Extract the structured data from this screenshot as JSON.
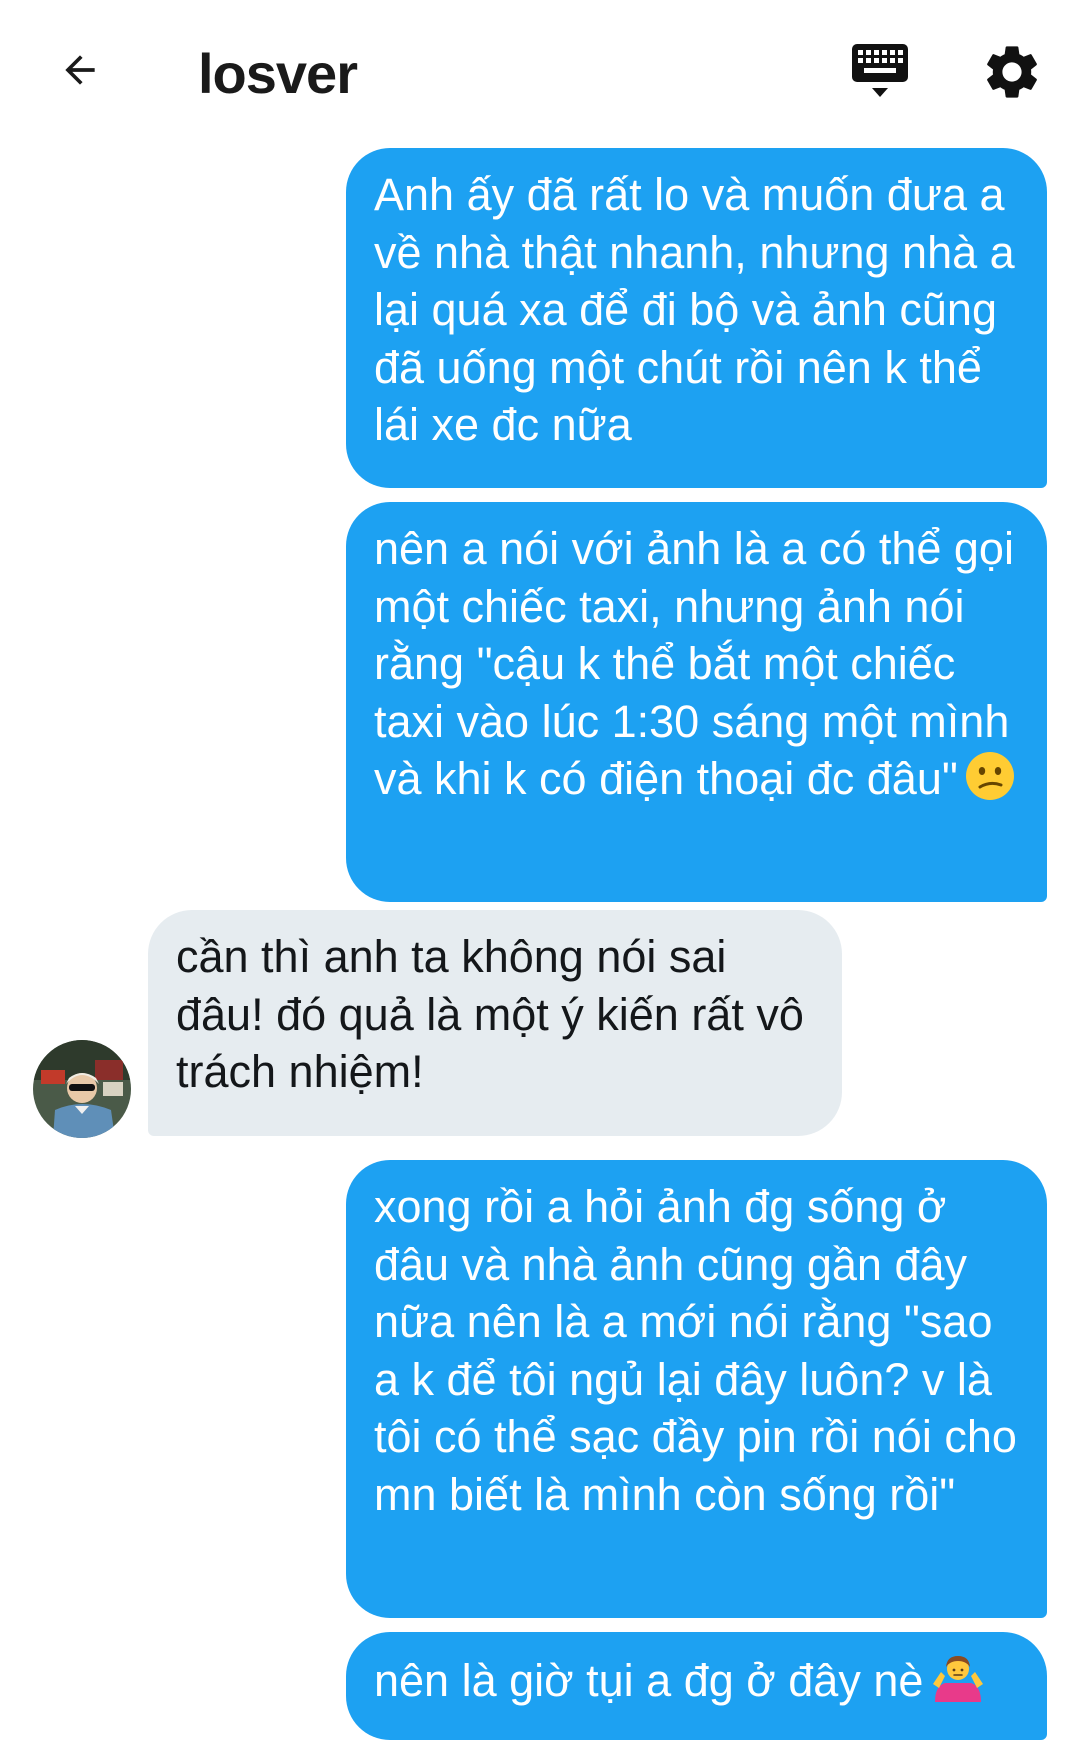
{
  "header": {
    "title": "losver",
    "back_icon": "arrow-left-icon",
    "keyboard_icon": "keyboard-icon",
    "settings_icon": "gear-icon"
  },
  "colors": {
    "outgoing_bubble": "#1da1f2",
    "incoming_bubble": "#e6ecf0"
  },
  "messages": [
    {
      "direction": "outgoing",
      "text": "Anh ấy đã rất lo và muốn đưa a về nhà thật nhanh, nhưng nhà a lại quá xa để đi bộ và ảnh cũng đã uống một chút rồi nên k thể lái xe đc nữa"
    },
    {
      "direction": "outgoing",
      "text": "nên a nói với ảnh là a có thể gọi một chiếc taxi, nhưng ảnh nói rằng \"cậu k thể bắt một chiếc taxi vào lúc 1:30 sáng một mình và khi k có điện thoại đc đâu\"",
      "emoji": "confused-face-icon"
    },
    {
      "direction": "incoming",
      "text": "cần thì anh ta không nói sai đâu! đó quả là một ý kiến rất vô trách nhiệm!",
      "avatar": "avatar"
    },
    {
      "direction": "outgoing",
      "text": "xong rồi a hỏi ảnh đg sống ở đâu và nhà ảnh cũng gần đây nữa nên là a mới nói rằng \"sao a k để tôi ngủ lại đây luôn? v là tôi có thể sạc đầy pin rồi nói cho mn biết là mình còn sống rồi\""
    },
    {
      "direction": "outgoing",
      "text": "nên là giờ tụi a đg ở đây nè",
      "emoji": "person-shrugging-icon"
    }
  ]
}
